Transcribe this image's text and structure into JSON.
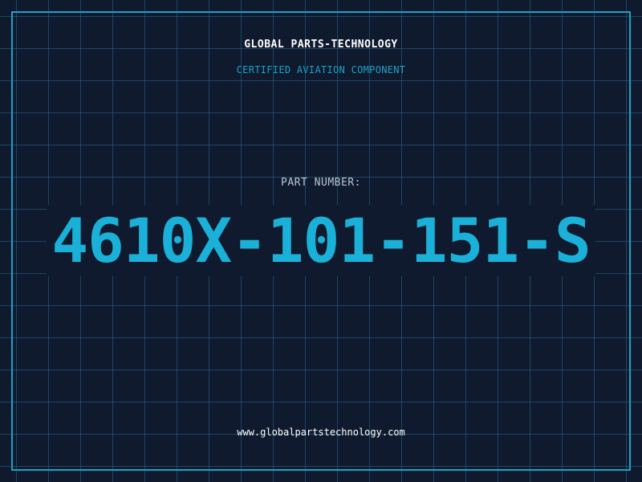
{
  "header": {
    "company": "GLOBAL PARTS-TECHNOLOGY",
    "subtitle": "CERTIFIED AVIATION COMPONENT"
  },
  "part": {
    "label": "PART NUMBER:",
    "number": "4610X-101-151-S"
  },
  "footer": {
    "website": "www.globalpartstechnology.com"
  },
  "colors": {
    "background": "#101a2e",
    "accent": "#1ab0d8",
    "grid": "#1e6e8c",
    "text": "#ffffff"
  }
}
